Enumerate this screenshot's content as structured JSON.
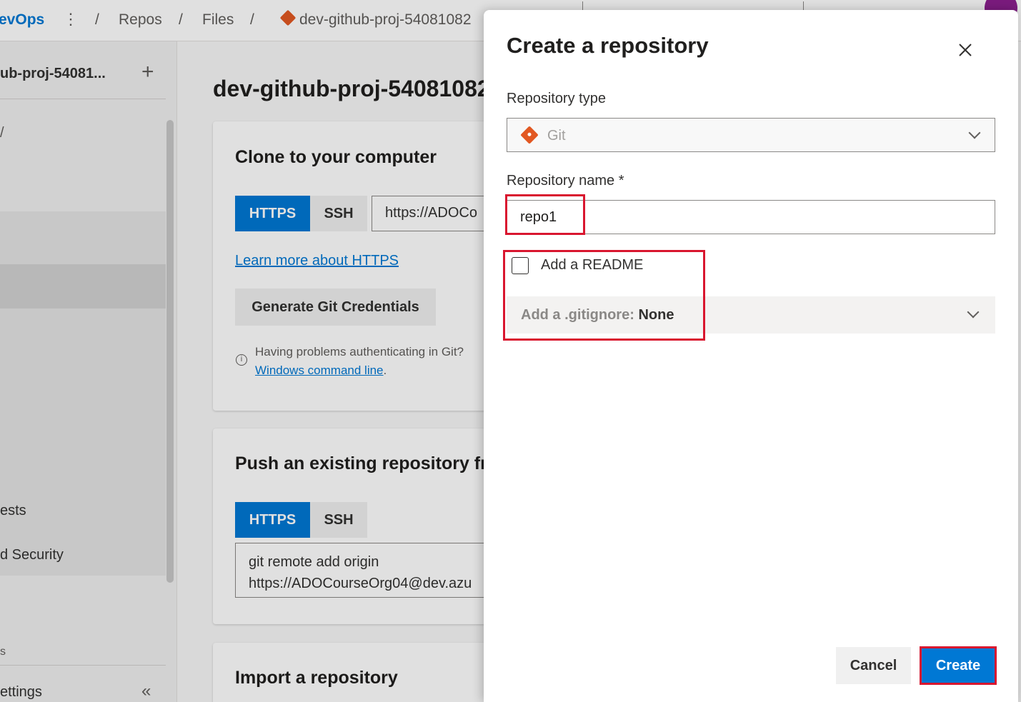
{
  "topbar": {
    "brand": "evOps",
    "sep": "/",
    "crumbs": [
      "Repos",
      "Files"
    ],
    "repo_crumb": "dev-github-proj-54081082"
  },
  "sidebar": {
    "project": "ub-proj-54081...",
    "partial_items": [
      "/",
      "ests",
      "d Security",
      "s"
    ],
    "settings": "ettings"
  },
  "main": {
    "title": "dev-github-proj-54081082",
    "clone": {
      "heading": "Clone to your computer",
      "https": "HTTPS",
      "ssh": "SSH",
      "url": "https://ADOCo",
      "learn_link": "Learn more about HTTPS",
      "gen_button": "Generate Git Credentials",
      "problem_text": "Having problems authenticating in Git?",
      "cmd_link": "Windows command line",
      "period": "."
    },
    "push": {
      "heading": "Push an existing repository fr",
      "https": "HTTPS",
      "ssh": "SSH",
      "code_line1": "git remote add origin",
      "code_line2": "https://ADOCourseOrg04@dev.azu"
    },
    "import_heading": "Import a repository"
  },
  "dialog": {
    "title": "Create a repository",
    "repo_type_label": "Repository type",
    "repo_type_value": "Git",
    "repo_name_label": "Repository name *",
    "repo_name_value": "repo1",
    "readme_label": "Add a README",
    "readme_checked": false,
    "gitignore_prefix": "Add a .gitignore:",
    "gitignore_value": "None",
    "cancel": "Cancel",
    "create": "Create"
  },
  "colors": {
    "accent": "#0078d4",
    "highlight": "#d9162f",
    "git": "#e25822"
  }
}
